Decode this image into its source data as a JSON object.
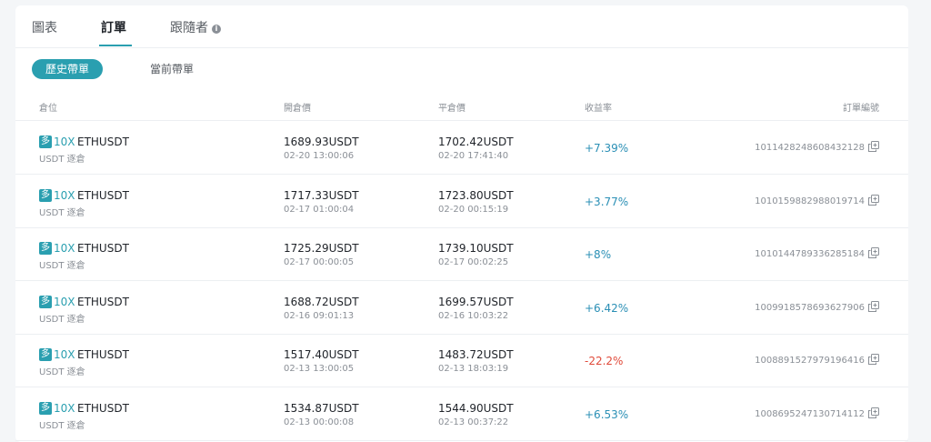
{
  "tabs": [
    {
      "label": "圖表"
    },
    {
      "label": "訂單"
    },
    {
      "label": "跟隨者"
    }
  ],
  "info_icon": "info-icon",
  "sub_tabs": [
    {
      "label": "歷史帶單"
    },
    {
      "label": "當前帶單"
    }
  ],
  "table": {
    "headers": {
      "position": "倉位",
      "open_price": "開倉價",
      "close_price": "平倉價",
      "yield": "收益率",
      "order_no": "訂單編號"
    },
    "rows": [
      {
        "side": "多",
        "leverage": "10X",
        "symbol": "ETHUSDT",
        "mode": "USDT 逐倉",
        "open_price": "1689.93USDT",
        "open_time": "02-20 13:00:06",
        "close_price": "1702.42USDT",
        "close_time": "02-20 17:41:40",
        "yield": "+7.39%",
        "yield_dir": "pos",
        "order_no": "1011428248608432128"
      },
      {
        "side": "多",
        "leverage": "10X",
        "symbol": "ETHUSDT",
        "mode": "USDT 逐倉",
        "open_price": "1717.33USDT",
        "open_time": "02-17 01:00:04",
        "close_price": "1723.80USDT",
        "close_time": "02-20 00:15:19",
        "yield": "+3.77%",
        "yield_dir": "pos",
        "order_no": "1010159882988019714"
      },
      {
        "side": "多",
        "leverage": "10X",
        "symbol": "ETHUSDT",
        "mode": "USDT 逐倉",
        "open_price": "1725.29USDT",
        "open_time": "02-17 00:00:05",
        "close_price": "1739.10USDT",
        "close_time": "02-17 00:02:25",
        "yield": "+8%",
        "yield_dir": "pos",
        "order_no": "1010144789336285184"
      },
      {
        "side": "多",
        "leverage": "10X",
        "symbol": "ETHUSDT",
        "mode": "USDT 逐倉",
        "open_price": "1688.72USDT",
        "open_time": "02-16 09:01:13",
        "close_price": "1699.57USDT",
        "close_time": "02-16 10:03:22",
        "yield": "+6.42%",
        "yield_dir": "pos",
        "order_no": "1009918578693627906"
      },
      {
        "side": "多",
        "leverage": "10X",
        "symbol": "ETHUSDT",
        "mode": "USDT 逐倉",
        "open_price": "1517.40USDT",
        "open_time": "02-13 13:00:05",
        "close_price": "1483.72USDT",
        "close_time": "02-13 18:03:19",
        "yield": "-22.2%",
        "yield_dir": "neg",
        "order_no": "1008891527979196416"
      },
      {
        "side": "多",
        "leverage": "10X",
        "symbol": "ETHUSDT",
        "mode": "USDT 逐倉",
        "open_price": "1534.87USDT",
        "open_time": "02-13 00:00:08",
        "close_price": "1544.90USDT",
        "close_time": "02-13 00:37:22",
        "yield": "+6.53%",
        "yield_dir": "pos",
        "order_no": "1008695247130714112"
      }
    ]
  },
  "copy_icon": "copy-icon",
  "colors": {
    "accent": "#2a9fb0",
    "positive": "#2a8fb5",
    "negative": "#e04a3a"
  }
}
